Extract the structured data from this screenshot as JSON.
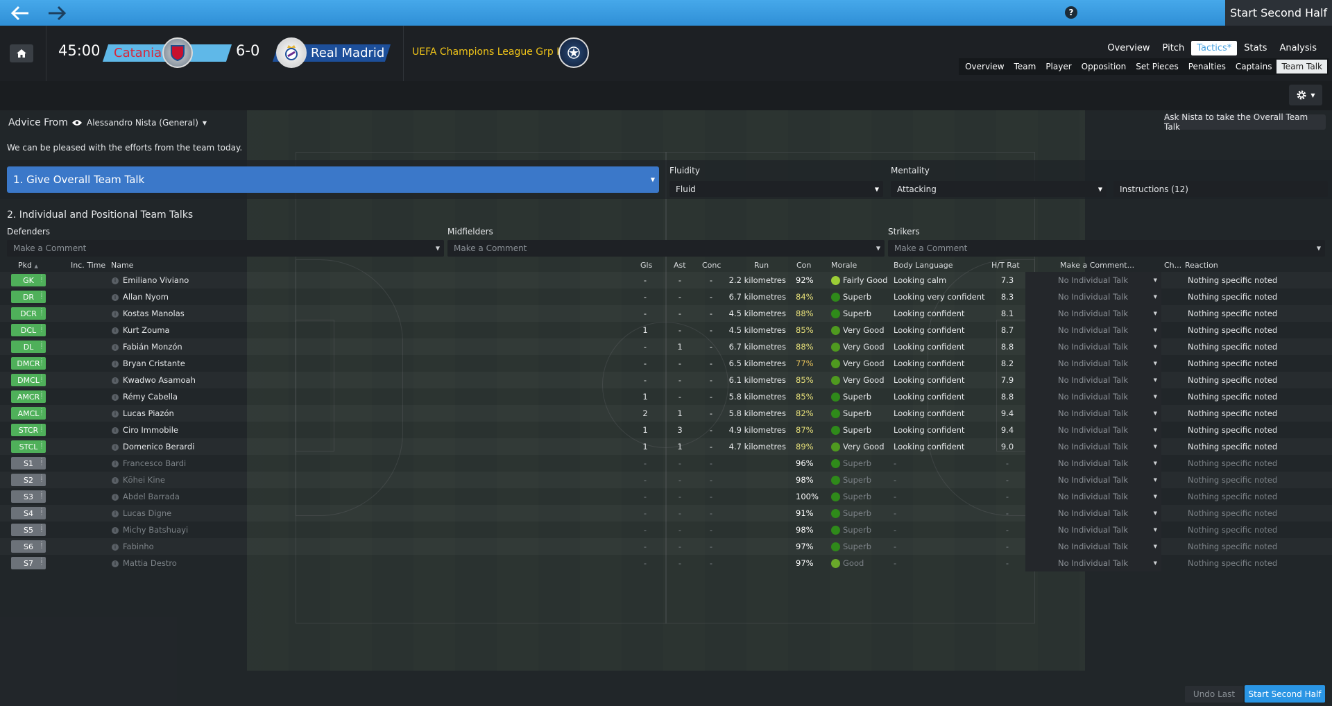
{
  "topbar": {
    "start_label": "Start Second Half",
    "help_label": "?"
  },
  "match": {
    "clock": "45:00",
    "home_team": "Catania",
    "score": "6-0",
    "away_team": "Real Madrid",
    "competition": "UEFA Champions League Grp H"
  },
  "main_tabs": [
    "Overview",
    "Pitch",
    "Tactics*",
    "Stats",
    "Analysis"
  ],
  "sub_tabs": [
    "Overview",
    "Team",
    "Player",
    "Opposition",
    "Set Pieces",
    "Penalties",
    "Captains",
    "Team Talk"
  ],
  "advice": {
    "label": "Advice From",
    "person": "Alessandro Nista (General)",
    "ask_button": "Ask Nista to take the Overall Team Talk",
    "text": "We can be pleased with the efforts from the team today."
  },
  "overall": {
    "label": "1. Give Overall Team Talk",
    "fluidity_label": "Fluidity",
    "fluidity": "Fluid",
    "mentality_label": "Mentality",
    "mentality": "Attacking",
    "instructions": "Instructions (12)"
  },
  "individual": {
    "title": "2. Individual and Positional Team Talks",
    "groups": [
      {
        "label": "Defenders",
        "placeholder": "Make a Comment"
      },
      {
        "label": "Midfielders",
        "placeholder": "Make a Comment"
      },
      {
        "label": "Strikers",
        "placeholder": "Make a Comment"
      }
    ]
  },
  "table": {
    "headers": {
      "pos": "Pkd",
      "inc": "Inc. Time",
      "name": "Name",
      "gls": "Gls",
      "ast": "Ast",
      "conc": "Conc",
      "run": "Run",
      "con": "Con",
      "morale": "Morale",
      "body": "Body Language",
      "rat": "H/T Rat",
      "comment": "Make a Comment...",
      "ch": "Ch...",
      "reaction": "Reaction"
    },
    "rows": [
      {
        "pos": "GK",
        "name": "Emiliano Viviano",
        "gls": "-",
        "ast": "-",
        "conc": "-",
        "run": "2.2 kilometres",
        "con": "92%",
        "morale": "Fairly Good",
        "body": "Looking calm",
        "rat": "7.3",
        "talk": "No Individual Talk",
        "reaction": "Nothing specific noted"
      },
      {
        "pos": "DR",
        "name": "Allan Nyom",
        "gls": "-",
        "ast": "-",
        "conc": "-",
        "run": "6.7 kilometres",
        "con": "84%",
        "morale": "Superb",
        "body": "Looking very confident",
        "rat": "8.3",
        "talk": "No Individual Talk",
        "reaction": "Nothing specific noted"
      },
      {
        "pos": "DCR",
        "name": "Kostas Manolas",
        "gls": "-",
        "ast": "-",
        "conc": "-",
        "run": "4.5 kilometres",
        "con": "88%",
        "morale": "Superb",
        "body": "Looking confident",
        "rat": "8.1",
        "talk": "No Individual Talk",
        "reaction": "Nothing specific noted"
      },
      {
        "pos": "DCL",
        "name": "Kurt Zouma",
        "gls": "1",
        "ast": "-",
        "conc": "-",
        "run": "4.5 kilometres",
        "con": "85%",
        "morale": "Very Good",
        "body": "Looking confident",
        "rat": "8.7",
        "talk": "No Individual Talk",
        "reaction": "Nothing specific noted"
      },
      {
        "pos": "DL",
        "name": "Fabián Monzón",
        "gls": "-",
        "ast": "1",
        "conc": "-",
        "run": "6.7 kilometres",
        "con": "88%",
        "morale": "Very Good",
        "body": "Looking confident",
        "rat": "8.8",
        "talk": "No Individual Talk",
        "reaction": "Nothing specific noted"
      },
      {
        "pos": "DMCR",
        "name": "Bryan Cristante",
        "gls": "-",
        "ast": "-",
        "conc": "-",
        "run": "6.5 kilometres",
        "con": "77%",
        "morale": "Very Good",
        "body": "Looking confident",
        "rat": "8.2",
        "talk": "No Individual Talk",
        "reaction": "Nothing specific noted"
      },
      {
        "pos": "DMCL",
        "name": "Kwadwo Asamoah",
        "gls": "-",
        "ast": "-",
        "conc": "-",
        "run": "6.1 kilometres",
        "con": "85%",
        "morale": "Very Good",
        "body": "Looking confident",
        "rat": "7.9",
        "talk": "No Individual Talk",
        "reaction": "Nothing specific noted"
      },
      {
        "pos": "AMCR",
        "name": "Rémy Cabella",
        "gls": "1",
        "ast": "-",
        "conc": "-",
        "run": "5.8 kilometres",
        "con": "85%",
        "morale": "Superb",
        "body": "Looking confident",
        "rat": "8.8",
        "talk": "No Individual Talk",
        "reaction": "Nothing specific noted"
      },
      {
        "pos": "AMCL",
        "name": "Lucas Piazón",
        "gls": "2",
        "ast": "1",
        "conc": "-",
        "run": "5.8 kilometres",
        "con": "82%",
        "morale": "Superb",
        "body": "Looking confident",
        "rat": "9.4",
        "talk": "No Individual Talk",
        "reaction": "Nothing specific noted"
      },
      {
        "pos": "STCR",
        "name": "Ciro Immobile",
        "gls": "1",
        "ast": "3",
        "conc": "-",
        "run": "4.9 kilometres",
        "con": "87%",
        "morale": "Superb",
        "body": "Looking confident",
        "rat": "9.4",
        "talk": "No Individual Talk",
        "reaction": "Nothing specific noted"
      },
      {
        "pos": "STCL",
        "name": "Domenico Berardi",
        "gls": "1",
        "ast": "1",
        "conc": "-",
        "run": "4.7 kilometres",
        "con": "89%",
        "morale": "Very Good",
        "body": "Looking confident",
        "rat": "9.0",
        "talk": "No Individual Talk",
        "reaction": "Nothing specific noted"
      },
      {
        "pos": "S1",
        "name": "Francesco Bardi",
        "gls": "-",
        "ast": "-",
        "conc": "-",
        "run": "",
        "con": "96%",
        "morale": "Superb",
        "body": "-",
        "rat": "-",
        "talk": "No Individual Talk",
        "reaction": "Nothing specific noted"
      },
      {
        "pos": "S2",
        "name": "Kōhei Kine",
        "gls": "-",
        "ast": "-",
        "conc": "-",
        "run": "",
        "con": "98%",
        "morale": "Superb",
        "body": "-",
        "rat": "-",
        "talk": "No Individual Talk",
        "reaction": "Nothing specific noted"
      },
      {
        "pos": "S3",
        "name": "Abdel Barrada",
        "gls": "-",
        "ast": "-",
        "conc": "-",
        "run": "",
        "con": "100%",
        "morale": "Superb",
        "body": "-",
        "rat": "-",
        "talk": "No Individual Talk",
        "reaction": "Nothing specific noted"
      },
      {
        "pos": "S4",
        "name": "Lucas Digne",
        "gls": "-",
        "ast": "-",
        "conc": "-",
        "run": "",
        "con": "91%",
        "morale": "Superb",
        "body": "-",
        "rat": "-",
        "talk": "No Individual Talk",
        "reaction": "Nothing specific noted"
      },
      {
        "pos": "S5",
        "name": "Michy Batshuayi",
        "gls": "-",
        "ast": "-",
        "conc": "-",
        "run": "",
        "con": "98%",
        "morale": "Superb",
        "body": "-",
        "rat": "-",
        "talk": "No Individual Talk",
        "reaction": "Nothing specific noted"
      },
      {
        "pos": "S6",
        "name": "Fabinho",
        "gls": "-",
        "ast": "-",
        "conc": "-",
        "run": "",
        "con": "97%",
        "morale": "Superb",
        "body": "-",
        "rat": "-",
        "talk": "No Individual Talk",
        "reaction": "Nothing specific noted"
      },
      {
        "pos": "S7",
        "name": "Mattia Destro",
        "gls": "-",
        "ast": "-",
        "conc": "-",
        "run": "",
        "con": "97%",
        "morale": "Good",
        "body": "-",
        "rat": "-",
        "talk": "No Individual Talk",
        "reaction": "Nothing specific noted"
      }
    ]
  },
  "footer": {
    "undo_label": "Undo Last",
    "start_label": "Start Second Half"
  },
  "colors": {
    "topbar": "#2f8fd6",
    "starter_pos": "#4fb05a",
    "sub_pos": "#6c7279",
    "primary_button": "#2a95e4",
    "overall_talk": "#3b78c9",
    "competition_text": "#f0c419",
    "home_team_text": "#d7263a"
  },
  "icons": {
    "back": "arrow-left-icon",
    "forward": "arrow-right-icon",
    "home": "home-icon",
    "eye": "eye-icon",
    "gear": "gear-icon",
    "info": "info-icon",
    "home_crest": "catania-crest-icon",
    "away_crest": "real-madrid-crest-icon",
    "competition_crest": "champions-league-icon"
  }
}
